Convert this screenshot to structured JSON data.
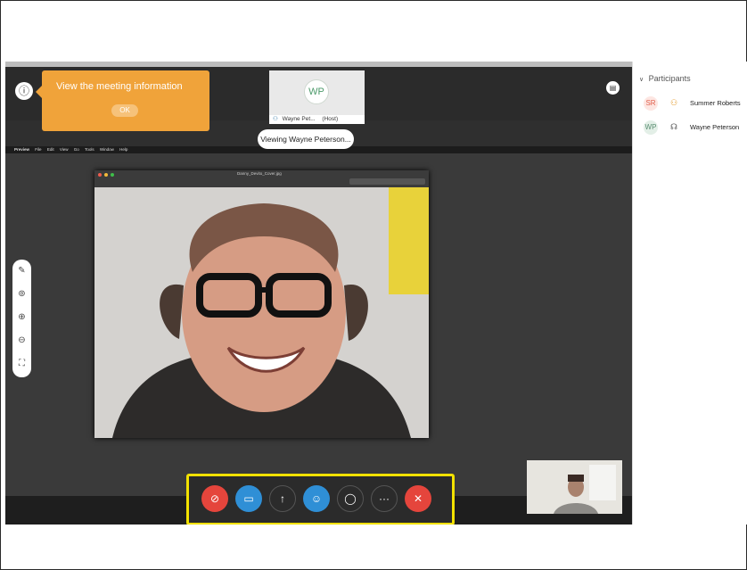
{
  "tooltip": {
    "text": "View the meeting information",
    "ok": "OK"
  },
  "host": {
    "initials": "WP",
    "name": "Wayne Pet...",
    "role": "(Host)"
  },
  "viewing_label": "Viewing Wayne Peterson...",
  "mac_menu": [
    "Preview",
    "File",
    "Edit",
    "View",
    "Go",
    "Tools",
    "Window",
    "Help"
  ],
  "preview_title": "Danny_Devito_Cover.jpg",
  "participants": {
    "header": "Participants",
    "people": [
      {
        "initials": "SR",
        "name": "Summer Roberts",
        "color": "#e0604d"
      },
      {
        "initials": "WP",
        "name": "Wayne Peterson",
        "color": "#5b8f73"
      }
    ]
  },
  "controls": {
    "mute_color": "#e5453c",
    "video_color": "#2f8fd6",
    "participants_color": "#2f8fd6",
    "leave_color": "#e5453c"
  },
  "icons": {
    "info": "info-icon",
    "layout": "layout-icon",
    "mute": "mic-off-icon",
    "video": "camera-icon",
    "share": "share-icon",
    "participants": "participants-icon",
    "chat": "chat-icon",
    "more": "more-icon",
    "leave": "close-icon"
  }
}
